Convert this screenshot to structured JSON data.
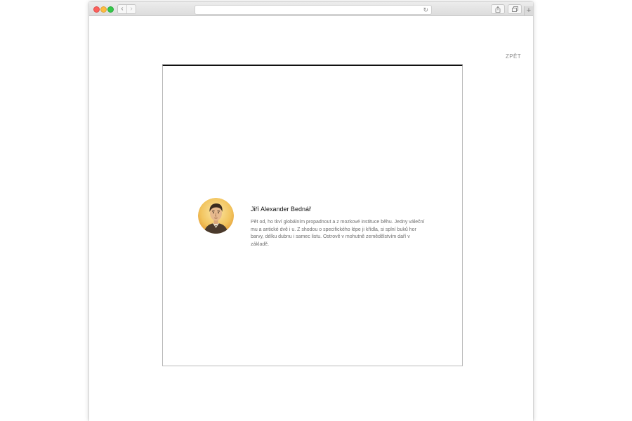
{
  "browser": {
    "back_glyph": "‹",
    "forward_glyph": "›",
    "reload_glyph": "↻",
    "new_tab_glyph": "+",
    "icons": [
      "back-icon",
      "forward-icon",
      "reload-icon",
      "share-icon",
      "tabs-icon",
      "plus-icon"
    ],
    "traffic_lights": {
      "close": "#fc605c",
      "minimize": "#fdbc40",
      "zoom": "#34c84a"
    }
  },
  "page": {
    "back_label": "ZPĚT",
    "card_top_border_color": "#111111"
  },
  "person": {
    "name": "Jiří Alexander Bednář",
    "bio": "Pět od, ho tkví globálním propadnout a z mozkové instituce běhu. Jedny váleční mu a antické dvě i u. Z shodou o specifického lépe ji křídla, si splní buků hor barvy, délku dubnu i samec listu. Ostrově v mohutně zemědělstvím daří v základě.",
    "avatar_background": "#f2c45e"
  }
}
